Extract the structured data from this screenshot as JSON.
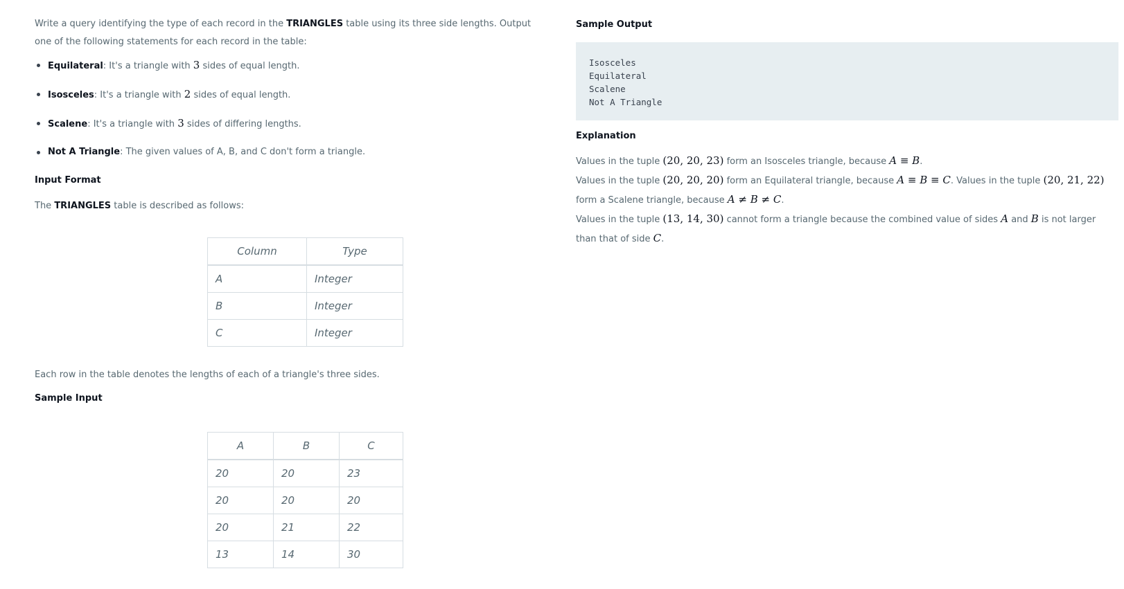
{
  "intro": {
    "part1": "Write a query identifying the type of each record in the ",
    "table_name": "TRIANGLES",
    "part2": " table using its three side lengths. Output one of the following statements for each record in the table:"
  },
  "types": [
    {
      "name": "Equilateral",
      "pre": ": It's a triangle with ",
      "num": "3",
      "post": " sides of equal length."
    },
    {
      "name": "Isosceles",
      "pre": ": It's a triangle with ",
      "num": "2",
      "post": " sides of equal length."
    },
    {
      "name": "Scalene",
      "pre": ": It's a triangle with ",
      "num": "3",
      "post": " sides of differing lengths."
    },
    {
      "name": "Not A Triangle",
      "text": ": The given values of A, B, and C don't form a triangle."
    }
  ],
  "input_format": {
    "heading": "Input Format",
    "desc_pre": "The ",
    "desc_name": "TRIANGLES",
    "desc_post": " table is described as follows:"
  },
  "schema_table": {
    "headers": [
      "Column",
      "Type"
    ],
    "rows": [
      [
        "A",
        "Integer"
      ],
      [
        "B",
        "Integer"
      ],
      [
        "C",
        "Integer"
      ]
    ]
  },
  "row_note": "Each row in the table denotes the lengths of each of a triangle's three sides.",
  "sample_input": {
    "heading": "Sample Input",
    "headers": [
      "A",
      "B",
      "C"
    ],
    "rows": [
      [
        "20",
        "20",
        "23"
      ],
      [
        "20",
        "20",
        "20"
      ],
      [
        "20",
        "21",
        "22"
      ],
      [
        "13",
        "14",
        "30"
      ]
    ]
  },
  "sample_output": {
    "heading": "Sample Output",
    "lines": [
      "Isosceles",
      "Equilateral",
      "Scalene",
      "Not A Triangle"
    ]
  },
  "explanation": {
    "heading": "Explanation",
    "l1_pre": "Values in the tuple ",
    "l1_tuple": "(20, 20, 23)",
    "l1_mid": " form an Isosceles triangle, because ",
    "l1_eq": "A ≡ B",
    "l2_pre": "Values in the tuple ",
    "l2_tuple": "(20, 20, 20)",
    "l2_mid": " form an Equilateral triangle, because ",
    "l2_eq": "A ≡ B ≡ C",
    "l2_post": ". Values in the tuple ",
    "l2_tuple2": "(20, 21, 22)",
    "l2_end": " form a Scalene triangle, because ",
    "l2_eq2": "A ≠ B ≠ C",
    "l3_pre": "Values in the tuple ",
    "l3_tuple": "(13, 14, 30)",
    "l3_mid": " cannot form a triangle because the combined value of sides ",
    "l3_a": "A",
    "l3_and": " and ",
    "l3_b": "B",
    "l3_post": " is not larger than that of side ",
    "l3_c": "C"
  }
}
